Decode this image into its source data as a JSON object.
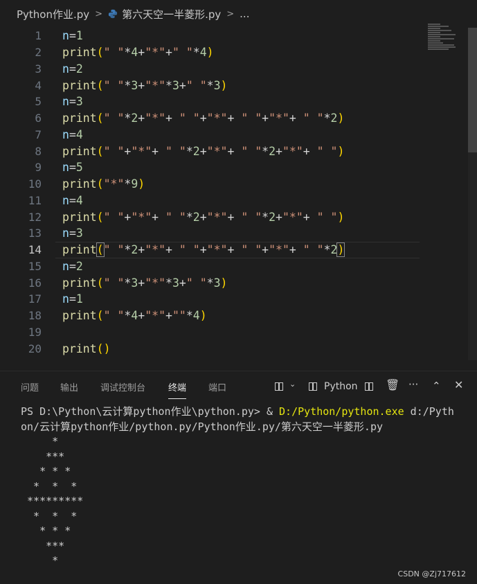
{
  "breadcrumb": {
    "folder": "Python作业.py",
    "file": "第六天空一半菱形.py",
    "more": "..."
  },
  "editor": {
    "active_line": 14,
    "lines": [
      {
        "n": "1",
        "tokens": [
          {
            "t": "n",
            "c": "var"
          },
          {
            "t": "=",
            "c": "op"
          },
          {
            "t": "1",
            "c": "num"
          }
        ]
      },
      {
        "n": "2",
        "tokens": [
          {
            "t": "print",
            "c": "fn"
          },
          {
            "t": "(",
            "c": "br"
          },
          {
            "t": "\" \"",
            "c": "str"
          },
          {
            "t": "*",
            "c": "op"
          },
          {
            "t": "4",
            "c": "num"
          },
          {
            "t": "+",
            "c": "op"
          },
          {
            "t": "\"*\"",
            "c": "str"
          },
          {
            "t": "+",
            "c": "op"
          },
          {
            "t": "\" \"",
            "c": "str"
          },
          {
            "t": "*",
            "c": "op"
          },
          {
            "t": "4",
            "c": "num"
          },
          {
            "t": ")",
            "c": "br"
          }
        ]
      },
      {
        "n": "3",
        "tokens": [
          {
            "t": "n",
            "c": "var"
          },
          {
            "t": "=",
            "c": "op"
          },
          {
            "t": "2",
            "c": "num"
          }
        ]
      },
      {
        "n": "4",
        "tokens": [
          {
            "t": "print",
            "c": "fn"
          },
          {
            "t": "(",
            "c": "br"
          },
          {
            "t": "\" \"",
            "c": "str"
          },
          {
            "t": "*",
            "c": "op"
          },
          {
            "t": "3",
            "c": "num"
          },
          {
            "t": "+",
            "c": "op"
          },
          {
            "t": "\"*\"",
            "c": "str"
          },
          {
            "t": "*",
            "c": "op"
          },
          {
            "t": "3",
            "c": "num"
          },
          {
            "t": "+",
            "c": "op"
          },
          {
            "t": "\" \"",
            "c": "str"
          },
          {
            "t": "*",
            "c": "op"
          },
          {
            "t": "3",
            "c": "num"
          },
          {
            "t": ")",
            "c": "br"
          }
        ]
      },
      {
        "n": "5",
        "tokens": [
          {
            "t": "n",
            "c": "var"
          },
          {
            "t": "=",
            "c": "op"
          },
          {
            "t": "3",
            "c": "num"
          }
        ]
      },
      {
        "n": "6",
        "tokens": [
          {
            "t": "print",
            "c": "fn"
          },
          {
            "t": "(",
            "c": "br"
          },
          {
            "t": "\" \"",
            "c": "str"
          },
          {
            "t": "*",
            "c": "op"
          },
          {
            "t": "2",
            "c": "num"
          },
          {
            "t": "+",
            "c": "op"
          },
          {
            "t": "\"*\"",
            "c": "str"
          },
          {
            "t": "+",
            "c": "op"
          },
          {
            "t": " ",
            "c": "op"
          },
          {
            "t": "\" \"",
            "c": "str"
          },
          {
            "t": "+",
            "c": "op"
          },
          {
            "t": "\"*\"",
            "c": "str"
          },
          {
            "t": "+",
            "c": "op"
          },
          {
            "t": " ",
            "c": "op"
          },
          {
            "t": "\" \"",
            "c": "str"
          },
          {
            "t": "+",
            "c": "op"
          },
          {
            "t": "\"*\"",
            "c": "str"
          },
          {
            "t": "+",
            "c": "op"
          },
          {
            "t": " ",
            "c": "op"
          },
          {
            "t": "\" \"",
            "c": "str"
          },
          {
            "t": "*",
            "c": "op"
          },
          {
            "t": "2",
            "c": "num"
          },
          {
            "t": ")",
            "c": "br"
          }
        ]
      },
      {
        "n": "7",
        "tokens": [
          {
            "t": "n",
            "c": "var"
          },
          {
            "t": "=",
            "c": "op"
          },
          {
            "t": "4",
            "c": "num"
          }
        ]
      },
      {
        "n": "8",
        "tokens": [
          {
            "t": "print",
            "c": "fn"
          },
          {
            "t": "(",
            "c": "br"
          },
          {
            "t": "\" \"",
            "c": "str"
          },
          {
            "t": "+",
            "c": "op"
          },
          {
            "t": "\"*\"",
            "c": "str"
          },
          {
            "t": "+",
            "c": "op"
          },
          {
            "t": " ",
            "c": "op"
          },
          {
            "t": "\" \"",
            "c": "str"
          },
          {
            "t": "*",
            "c": "op"
          },
          {
            "t": "2",
            "c": "num"
          },
          {
            "t": "+",
            "c": "op"
          },
          {
            "t": "\"*\"",
            "c": "str"
          },
          {
            "t": "+",
            "c": "op"
          },
          {
            "t": " ",
            "c": "op"
          },
          {
            "t": "\" \"",
            "c": "str"
          },
          {
            "t": "*",
            "c": "op"
          },
          {
            "t": "2",
            "c": "num"
          },
          {
            "t": "+",
            "c": "op"
          },
          {
            "t": "\"*\"",
            "c": "str"
          },
          {
            "t": "+",
            "c": "op"
          },
          {
            "t": " ",
            "c": "op"
          },
          {
            "t": "\" \"",
            "c": "str"
          },
          {
            "t": ")",
            "c": "br"
          }
        ]
      },
      {
        "n": "9",
        "tokens": [
          {
            "t": "n",
            "c": "var"
          },
          {
            "t": "=",
            "c": "op"
          },
          {
            "t": "5",
            "c": "num"
          }
        ]
      },
      {
        "n": "10",
        "tokens": [
          {
            "t": "print",
            "c": "fn"
          },
          {
            "t": "(",
            "c": "br"
          },
          {
            "t": "\"*\"",
            "c": "str"
          },
          {
            "t": "*",
            "c": "op"
          },
          {
            "t": "9",
            "c": "num"
          },
          {
            "t": ")",
            "c": "br"
          }
        ]
      },
      {
        "n": "11",
        "tokens": [
          {
            "t": "n",
            "c": "var"
          },
          {
            "t": "=",
            "c": "op"
          },
          {
            "t": "4",
            "c": "num"
          }
        ]
      },
      {
        "n": "12",
        "tokens": [
          {
            "t": "print",
            "c": "fn"
          },
          {
            "t": "(",
            "c": "br"
          },
          {
            "t": "\" \"",
            "c": "str"
          },
          {
            "t": "+",
            "c": "op"
          },
          {
            "t": "\"*\"",
            "c": "str"
          },
          {
            "t": "+",
            "c": "op"
          },
          {
            "t": " ",
            "c": "op"
          },
          {
            "t": "\" \"",
            "c": "str"
          },
          {
            "t": "*",
            "c": "op"
          },
          {
            "t": "2",
            "c": "num"
          },
          {
            "t": "+",
            "c": "op"
          },
          {
            "t": "\"*\"",
            "c": "str"
          },
          {
            "t": "+",
            "c": "op"
          },
          {
            "t": " ",
            "c": "op"
          },
          {
            "t": "\" \"",
            "c": "str"
          },
          {
            "t": "*",
            "c": "op"
          },
          {
            "t": "2",
            "c": "num"
          },
          {
            "t": "+",
            "c": "op"
          },
          {
            "t": "\"*\"",
            "c": "str"
          },
          {
            "t": "+",
            "c": "op"
          },
          {
            "t": " ",
            "c": "op"
          },
          {
            "t": "\" \"",
            "c": "str"
          },
          {
            "t": ")",
            "c": "br"
          }
        ]
      },
      {
        "n": "13",
        "tokens": [
          {
            "t": "n",
            "c": "var"
          },
          {
            "t": "=",
            "c": "op"
          },
          {
            "t": "3",
            "c": "num"
          }
        ]
      },
      {
        "n": "14",
        "tokens": [
          {
            "t": "print",
            "c": "fn"
          },
          {
            "t": "(",
            "c": "brbox"
          },
          {
            "t": "\" \"",
            "c": "str"
          },
          {
            "t": "*",
            "c": "op"
          },
          {
            "t": "2",
            "c": "num"
          },
          {
            "t": "+",
            "c": "op"
          },
          {
            "t": "\"*\"",
            "c": "str"
          },
          {
            "t": "+",
            "c": "op"
          },
          {
            "t": " ",
            "c": "op"
          },
          {
            "t": "\" \"",
            "c": "str"
          },
          {
            "t": "+",
            "c": "op"
          },
          {
            "t": "\"*\"",
            "c": "str"
          },
          {
            "t": "+",
            "c": "op"
          },
          {
            "t": " ",
            "c": "op"
          },
          {
            "t": "\" \"",
            "c": "str"
          },
          {
            "t": "+",
            "c": "op"
          },
          {
            "t": "\"*\"",
            "c": "str"
          },
          {
            "t": "+",
            "c": "op"
          },
          {
            "t": " ",
            "c": "op"
          },
          {
            "t": "\" \"",
            "c": "str"
          },
          {
            "t": "*",
            "c": "op"
          },
          {
            "t": "2",
            "c": "num"
          },
          {
            "t": ")",
            "c": "brbox"
          }
        ]
      },
      {
        "n": "15",
        "tokens": [
          {
            "t": "n",
            "c": "var"
          },
          {
            "t": "=",
            "c": "op"
          },
          {
            "t": "2",
            "c": "num"
          }
        ]
      },
      {
        "n": "16",
        "tokens": [
          {
            "t": "print",
            "c": "fn"
          },
          {
            "t": "(",
            "c": "br"
          },
          {
            "t": "\" \"",
            "c": "str"
          },
          {
            "t": "*",
            "c": "op"
          },
          {
            "t": "3",
            "c": "num"
          },
          {
            "t": "+",
            "c": "op"
          },
          {
            "t": "\"*\"",
            "c": "str"
          },
          {
            "t": "*",
            "c": "op"
          },
          {
            "t": "3",
            "c": "num"
          },
          {
            "t": "+",
            "c": "op"
          },
          {
            "t": "\" \"",
            "c": "str"
          },
          {
            "t": "*",
            "c": "op"
          },
          {
            "t": "3",
            "c": "num"
          },
          {
            "t": ")",
            "c": "br"
          }
        ]
      },
      {
        "n": "17",
        "tokens": [
          {
            "t": "n",
            "c": "var"
          },
          {
            "t": "=",
            "c": "op"
          },
          {
            "t": "1",
            "c": "num"
          }
        ]
      },
      {
        "n": "18",
        "tokens": [
          {
            "t": "print",
            "c": "fn"
          },
          {
            "t": "(",
            "c": "br"
          },
          {
            "t": "\" \"",
            "c": "str"
          },
          {
            "t": "*",
            "c": "op"
          },
          {
            "t": "4",
            "c": "num"
          },
          {
            "t": "+",
            "c": "op"
          },
          {
            "t": "\"*\"",
            "c": "str"
          },
          {
            "t": "+",
            "c": "op"
          },
          {
            "t": "\"\"",
            "c": "str"
          },
          {
            "t": "*",
            "c": "op"
          },
          {
            "t": "4",
            "c": "num"
          },
          {
            "t": ")",
            "c": "br"
          }
        ]
      },
      {
        "n": "19",
        "tokens": []
      },
      {
        "n": "20",
        "tokens": [
          {
            "t": "print",
            "c": "fn"
          },
          {
            "t": "()",
            "c": "br"
          }
        ]
      }
    ]
  },
  "panel": {
    "tabs": [
      {
        "label": "问题",
        "active": false
      },
      {
        "label": "输出",
        "active": false
      },
      {
        "label": "调试控制台",
        "active": false
      },
      {
        "label": "终端",
        "active": true
      },
      {
        "label": "端口",
        "active": false
      }
    ],
    "actions": {
      "layout_icon": "layout-icon",
      "terminal_label": "Python",
      "more": "···"
    },
    "terminal": {
      "prompt": "PS D:\\Python\\云计算python作业\\python.py> & ",
      "command_exe": "D:/Python/python.exe",
      "command_arg1": " d:/Pyth",
      "command_arg2": "on/云计算python作业/python.py/Python作业.py/第六天空一半菱形.py",
      "output": [
        "     *",
        "    ***",
        "   * * *",
        "  *  *  *",
        " *********",
        "  *  *  *",
        "   * * *",
        "    ***",
        "     *"
      ]
    }
  },
  "watermark": "CSDN @Zj717612",
  "colors": {
    "background": "#1e1e1e",
    "function": "#dcdcaa",
    "string": "#ce9178",
    "number": "#b5cea8",
    "variable": "#9cdcfe",
    "bracket": "#ffd700",
    "exe_path": "#e5e510"
  }
}
